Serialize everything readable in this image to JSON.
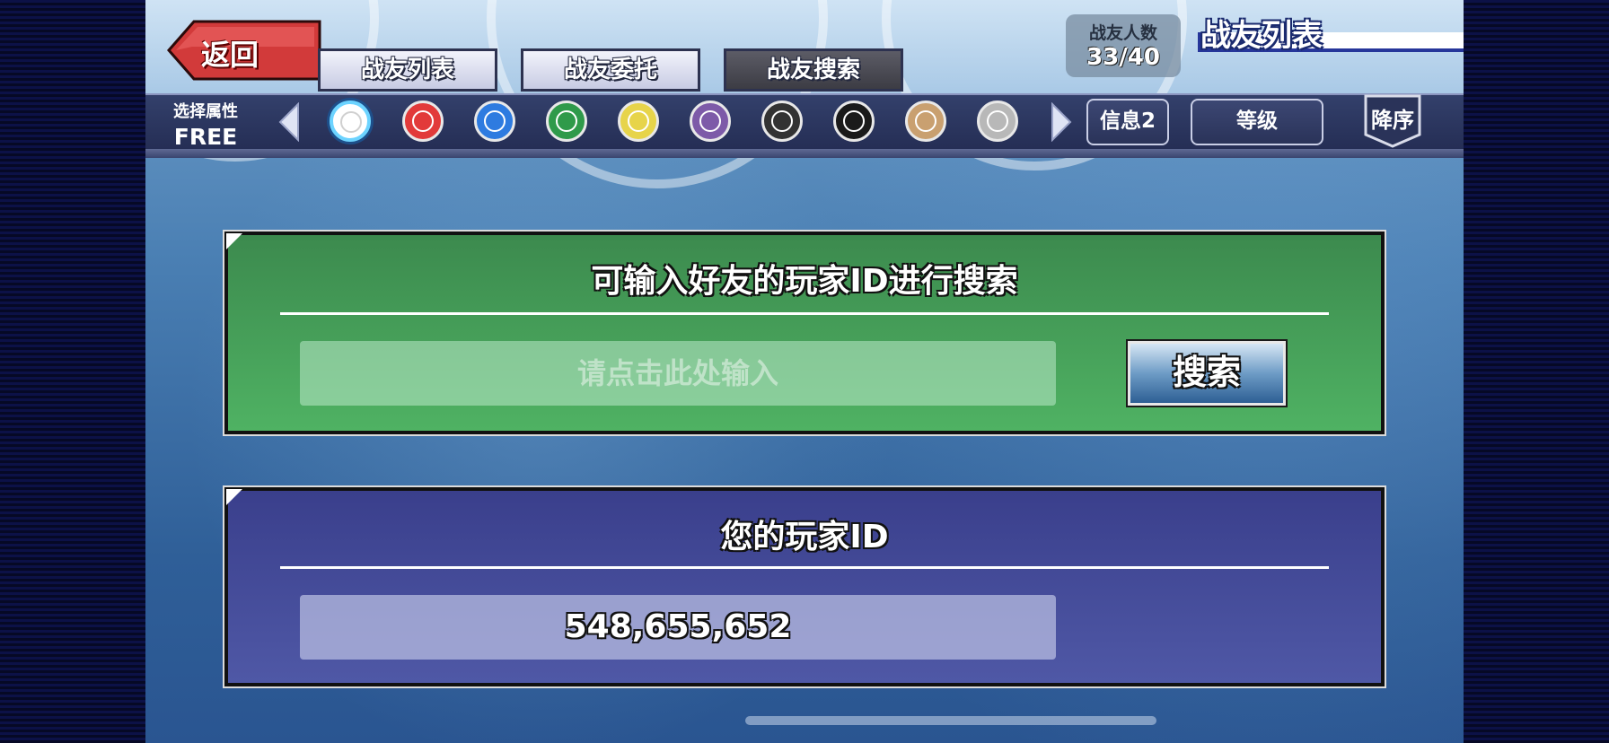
{
  "header": {
    "back_label": "返回",
    "tabs": [
      {
        "label": "战友列表",
        "active": false
      },
      {
        "label": "战友委托",
        "active": false
      },
      {
        "label": "战友搜索",
        "active": true
      }
    ],
    "friend_count_label": "战友人数",
    "friend_count_value": "33/40",
    "page_title": "战友列表"
  },
  "filter": {
    "attr_label": "选择属性",
    "attr_value": "FREE",
    "attributes": [
      {
        "icon": "all-attribute-icon",
        "color": "#ffffff",
        "ring": "#4a9fd8"
      },
      {
        "icon": "fire-attribute-icon",
        "color": "#e23a3a",
        "ring": "#b02020"
      },
      {
        "icon": "water-attribute-icon",
        "color": "#2e7be0",
        "ring": "#1a58b8"
      },
      {
        "icon": "wind-attribute-icon",
        "color": "#2f9a4a",
        "ring": "#1f7a35"
      },
      {
        "icon": "light-attribute-icon",
        "color": "#e7d44a",
        "ring": "#b8a62a"
      },
      {
        "icon": "dark-attribute-icon",
        "color": "#7d5aa8",
        "ring": "#5a3a88"
      },
      {
        "icon": "heaven-attribute-icon",
        "color": "#333333",
        "ring": "#111111"
      },
      {
        "icon": "chaos-attribute-icon",
        "color": "#1a1a1a",
        "ring": "#000000"
      },
      {
        "icon": "earth-attribute-icon",
        "color": "#c9a070",
        "ring": "#9c7648"
      },
      {
        "icon": "void-attribute-icon",
        "color": "#b8b8b8",
        "ring": "#888888"
      }
    ],
    "info_label": "信息2",
    "sort_label": "等级",
    "order_label": "降序"
  },
  "search_panel": {
    "title": "可输入好友的玩家ID进行搜索",
    "input_placeholder": "请点击此处输入",
    "input_value": "",
    "search_label": "搜索"
  },
  "id_panel": {
    "title": "您的玩家ID",
    "player_id": "548,655,652"
  },
  "colors": {
    "accent_green": "#3c8a4e",
    "accent_blue": "#3a3f8c",
    "back_red": "#d23a3a"
  }
}
